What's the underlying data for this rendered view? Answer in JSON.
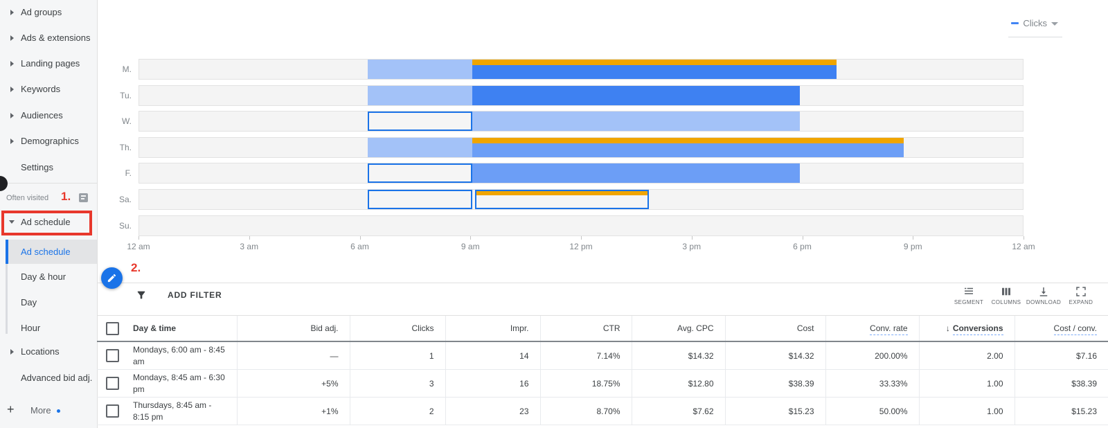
{
  "annotations": {
    "step1": "1.",
    "step2": "2."
  },
  "sidebar": {
    "top_items": [
      {
        "label": "Ad groups"
      },
      {
        "label": "Ads & extensions"
      },
      {
        "label": "Landing pages"
      },
      {
        "label": "Keywords"
      },
      {
        "label": "Audiences"
      },
      {
        "label": "Demographics"
      },
      {
        "label": "Settings",
        "no_arrow": true
      }
    ],
    "often_visited": "Often visited",
    "tree_parent": "Ad schedule",
    "tree_items": [
      {
        "label": "Ad schedule",
        "selected": true
      },
      {
        "label": "Day & hour"
      },
      {
        "label": "Day"
      },
      {
        "label": "Hour"
      }
    ],
    "locations": "Locations",
    "advanced_bid": "Advanced bid adj.",
    "more": "More"
  },
  "chart": {
    "legend_label": "Clicks",
    "colors": {
      "light": "#a3c2f8",
      "medium": "#6c9ef6",
      "dark": "#3e81f2",
      "orange": "#f0a500",
      "selection": "#1a73e8",
      "legend_dash": "#4285f4"
    },
    "x_ticks": [
      "12 am",
      "3 am",
      "6 am",
      "9 am",
      "12 pm",
      "3 pm",
      "6 pm",
      "9 pm",
      "12 am"
    ],
    "rows": [
      {
        "day": "M.",
        "segments": [
          {
            "start": 25.9,
            "end": 37.7,
            "type": "light"
          },
          {
            "start": 37.7,
            "end": 78.9,
            "type": "dark",
            "orange": true
          }
        ]
      },
      {
        "day": "Tu.",
        "segments": [
          {
            "start": 25.9,
            "end": 37.7,
            "type": "light"
          },
          {
            "start": 37.7,
            "end": 74.8,
            "type": "dark"
          }
        ]
      },
      {
        "day": "W.",
        "segments": [
          {
            "start": 25.9,
            "end": 37.7,
            "type": "box"
          },
          {
            "start": 37.7,
            "end": 74.8,
            "type": "light"
          }
        ]
      },
      {
        "day": "Th.",
        "segments": [
          {
            "start": 25.9,
            "end": 37.7,
            "type": "light"
          },
          {
            "start": 37.7,
            "end": 86.5,
            "type": "medium",
            "orange": true
          }
        ]
      },
      {
        "day": "F.",
        "segments": [
          {
            "start": 25.9,
            "end": 37.7,
            "type": "box"
          },
          {
            "start": 37.7,
            "end": 74.8,
            "type": "medium"
          }
        ]
      },
      {
        "day": "Sa.",
        "segments": [
          {
            "start": 25.9,
            "end": 37.7,
            "type": "box"
          },
          {
            "start": 38.0,
            "end": 57.7,
            "type": "box",
            "orange": true
          }
        ]
      },
      {
        "day": "Su.",
        "segments": []
      }
    ]
  },
  "toolbar": {
    "add_filter": "ADD FILTER",
    "actions": [
      {
        "label": "SEGMENT",
        "icon": "segment-icon"
      },
      {
        "label": "COLUMNS",
        "icon": "columns-icon"
      },
      {
        "label": "DOWNLOAD",
        "icon": "download-icon"
      },
      {
        "label": "EXPAND",
        "icon": "expand-icon"
      }
    ]
  },
  "table": {
    "columns": [
      {
        "label": "Day & time",
        "align": "left"
      },
      {
        "label": "Bid adj."
      },
      {
        "label": "Clicks"
      },
      {
        "label": "Impr."
      },
      {
        "label": "CTR"
      },
      {
        "label": "Avg. CPC"
      },
      {
        "label": "Cost"
      },
      {
        "label": "Conv. rate",
        "dotted": true
      },
      {
        "label": "Conversions",
        "sorted": true,
        "dotted": true
      },
      {
        "label": "Cost / conv.",
        "dotted": true
      }
    ],
    "rows": [
      {
        "cells": [
          "Mondays, 6:00 am - 8:45 am",
          "—",
          "1",
          "14",
          "7.14%",
          "$14.32",
          "$14.32",
          "200.00%",
          "2.00",
          "$7.16"
        ]
      },
      {
        "cells": [
          "Mondays, 8:45 am - 6:30 pm",
          "+5%",
          "3",
          "16",
          "18.75%",
          "$12.80",
          "$38.39",
          "33.33%",
          "1.00",
          "$38.39"
        ]
      },
      {
        "cells": [
          "Thursdays, 8:45 am - 8:15 pm",
          "+1%",
          "2",
          "23",
          "8.70%",
          "$7.62",
          "$15.23",
          "50.00%",
          "1.00",
          "$15.23"
        ]
      }
    ]
  }
}
